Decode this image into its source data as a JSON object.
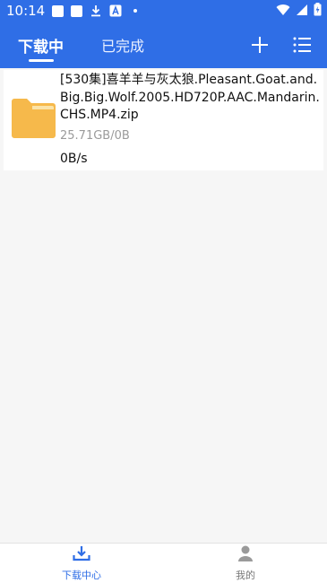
{
  "status_bar": {
    "time": "10:14"
  },
  "header": {
    "tabs": [
      {
        "label": "下载中",
        "active": true
      },
      {
        "label": "已完成",
        "active": false
      }
    ],
    "add_icon": "plus-icon",
    "menu_icon": "list-menu-icon"
  },
  "downloads": [
    {
      "name": "[530集]喜羊羊与灰太狼.Pleasant.Goat.and.Big.Big.Wolf.2005.HD720P.AAC.Mandarin.CHS.MP4.zip",
      "size": "25.71GB/0B",
      "speed": "0B/s",
      "icon": "folder-icon"
    }
  ],
  "bottom_nav": [
    {
      "label": "下载中心",
      "icon": "download-icon",
      "active": true
    },
    {
      "label": "我的",
      "icon": "user-icon",
      "active": false
    }
  ],
  "colors": {
    "primary": "#2f6ee6",
    "folder": "#f6b94b",
    "muted": "#9b9b9b"
  }
}
